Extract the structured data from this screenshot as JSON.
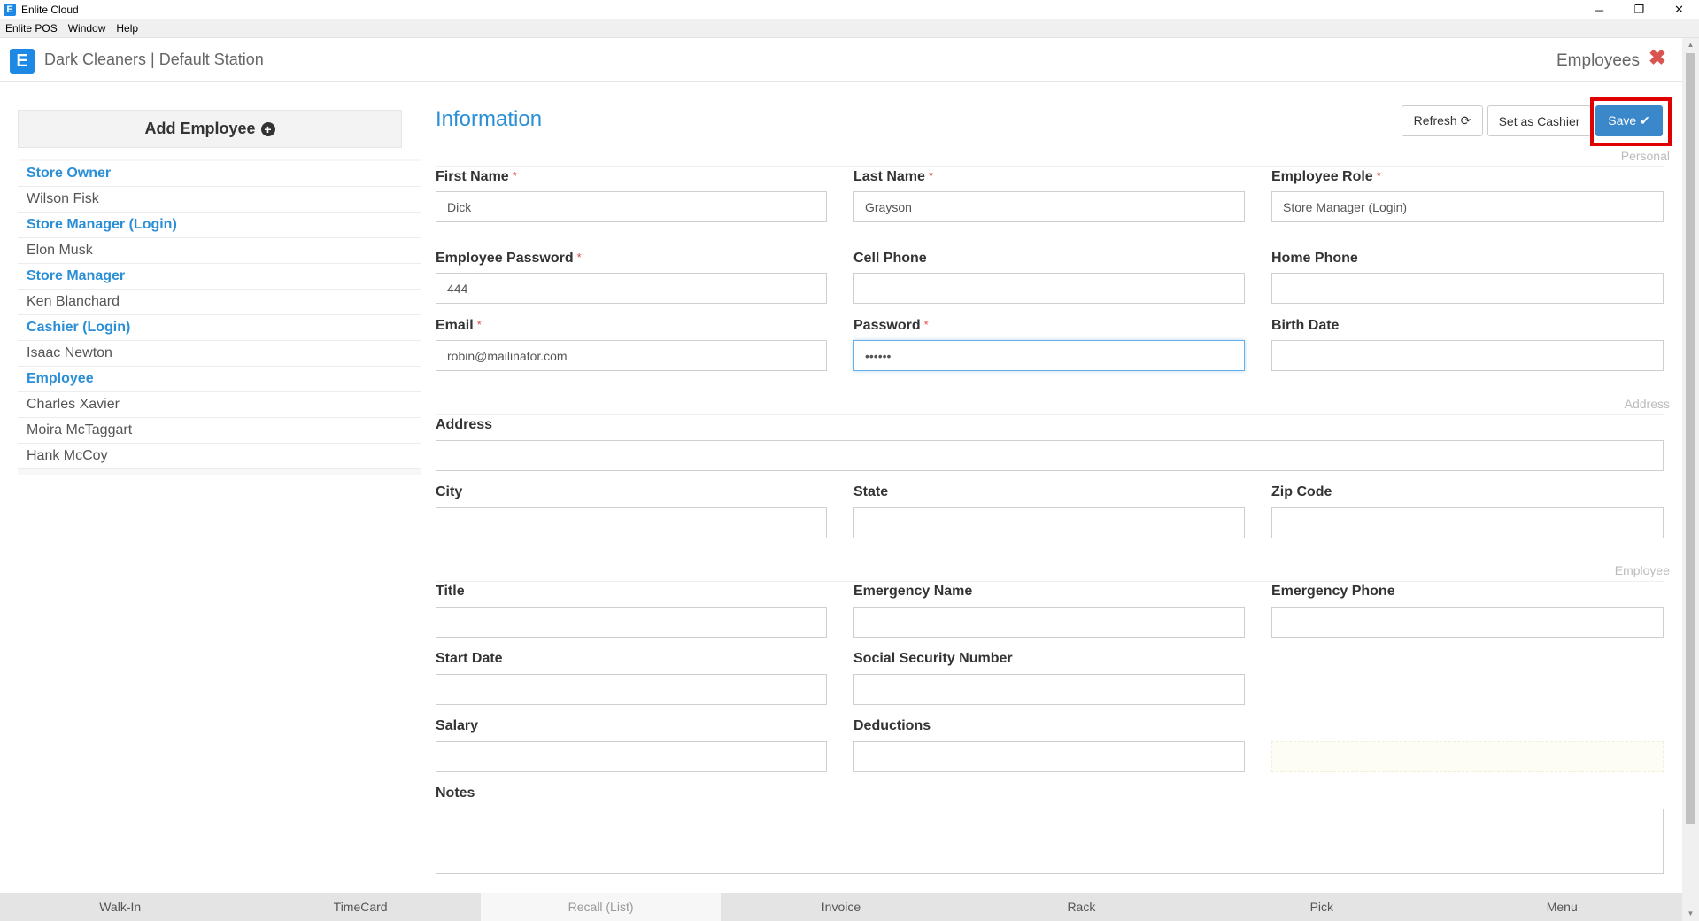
{
  "window": {
    "title": "Enlite Cloud",
    "logo_letter": "E",
    "controls": {
      "minimize": "─",
      "restore": "❐",
      "close": "✕"
    }
  },
  "menubar": [
    "Enlite POS",
    "Window",
    "Help"
  ],
  "header": {
    "logo_letter": "E",
    "station": "Dark Cleaners | Default Station",
    "page": "Employees",
    "close_glyph": "✖"
  },
  "sidebar": {
    "add_label": "Add Employee",
    "plus_glyph": "+",
    "items": [
      {
        "label": "Store Owner",
        "type": "group"
      },
      {
        "label": "Wilson Fisk",
        "type": "employee"
      },
      {
        "label": "Store Manager (Login)",
        "type": "group"
      },
      {
        "label": "Elon Musk",
        "type": "employee"
      },
      {
        "label": "Store Manager",
        "type": "group"
      },
      {
        "label": "Ken Blanchard",
        "type": "employee"
      },
      {
        "label": "Cashier (Login)",
        "type": "group"
      },
      {
        "label": "Isaac Newton",
        "type": "employee"
      },
      {
        "label": "Employee",
        "type": "group"
      },
      {
        "label": "Charles Xavier",
        "type": "employee"
      },
      {
        "label": "Moira McTaggart",
        "type": "employee"
      },
      {
        "label": "Hank McCoy",
        "type": "employee"
      }
    ]
  },
  "form": {
    "title": "Information",
    "buttons": {
      "refresh": "Refresh ⟳",
      "set_cashier": "Set as Cashier",
      "save": "Save ✔"
    },
    "sections": {
      "personal": "Personal",
      "address": "Address",
      "employee": "Employee"
    },
    "required_mark": "*",
    "fields": {
      "first_name": {
        "label": "First Name",
        "value": "Dick"
      },
      "last_name": {
        "label": "Last Name",
        "value": "Grayson"
      },
      "role": {
        "label": "Employee Role",
        "value": "Store Manager (Login)"
      },
      "emp_password": {
        "label": "Employee Password",
        "value": "444"
      },
      "cell_phone": {
        "label": "Cell Phone",
        "value": ""
      },
      "home_phone": {
        "label": "Home Phone",
        "value": ""
      },
      "email": {
        "label": "Email",
        "value": "robin@mailinator.com"
      },
      "password": {
        "label": "Password",
        "value": "••••••"
      },
      "birth_date": {
        "label": "Birth Date",
        "value": ""
      },
      "address": {
        "label": "Address",
        "value": ""
      },
      "city": {
        "label": "City",
        "value": ""
      },
      "state": {
        "label": "State",
        "value": ""
      },
      "zip": {
        "label": "Zip Code",
        "value": ""
      },
      "title": {
        "label": "Title",
        "value": ""
      },
      "emergency_name": {
        "label": "Emergency Name",
        "value": ""
      },
      "emergency_phone": {
        "label": "Emergency Phone",
        "value": ""
      },
      "start_date": {
        "label": "Start Date",
        "value": ""
      },
      "ssn": {
        "label": "Social Security Number",
        "value": ""
      },
      "salary": {
        "label": "Salary",
        "value": ""
      },
      "deductions": {
        "label": "Deductions",
        "value": ""
      },
      "notes": {
        "label": "Notes",
        "value": ""
      }
    }
  },
  "bottom_nav": [
    {
      "label": "Walk-In",
      "active": false
    },
    {
      "label": "TimeCard",
      "active": false
    },
    {
      "label": "Recall (List)",
      "active": true
    },
    {
      "label": "Invoice",
      "active": false
    },
    {
      "label": "Rack",
      "active": false
    },
    {
      "label": "Pick",
      "active": false
    },
    {
      "label": "Menu",
      "active": false
    }
  ]
}
